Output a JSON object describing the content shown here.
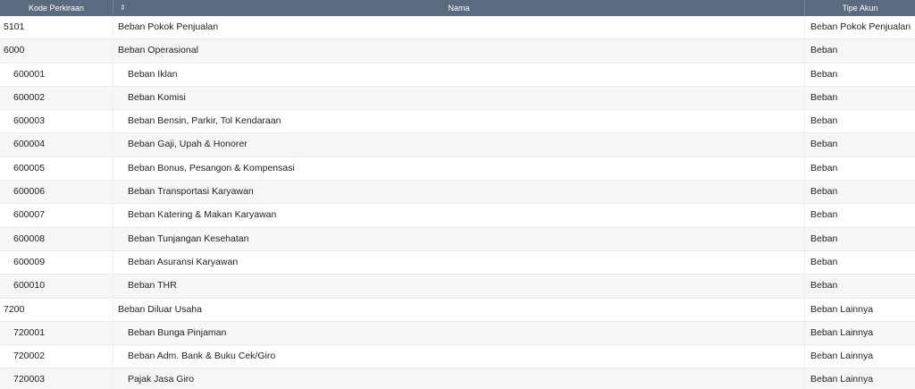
{
  "header": {
    "kode": "Kode Perkiraan",
    "sort_icon": "⇕",
    "nama": "Nama",
    "tipe": "Tipe Akun"
  },
  "rows": [
    {
      "kode": "5101",
      "nama": "Beban Pokok Penjualan",
      "tipe": "Beban Pokok Penjualan",
      "child": false
    },
    {
      "kode": "6000",
      "nama": "Beban Operasional",
      "tipe": "Beban",
      "child": false
    },
    {
      "kode": "600001",
      "nama": "Beban Iklan",
      "tipe": "Beban",
      "child": true
    },
    {
      "kode": "600002",
      "nama": "Beban Komisi",
      "tipe": "Beban",
      "child": true
    },
    {
      "kode": "600003",
      "nama": "Beban Bensin, Parkir, Tol Kendaraan",
      "tipe": "Beban",
      "child": true
    },
    {
      "kode": "600004",
      "nama": "Beban Gaji, Upah & Honorer",
      "tipe": "Beban",
      "child": true
    },
    {
      "kode": "600005",
      "nama": "Beban Bonus, Pesangon & Kompensasi",
      "tipe": "Beban",
      "child": true
    },
    {
      "kode": "600006",
      "nama": "Beban Transportasi Karyawan",
      "tipe": "Beban",
      "child": true
    },
    {
      "kode": "600007",
      "nama": "Beban Katering & Makan Karyawan",
      "tipe": "Beban",
      "child": true
    },
    {
      "kode": "600008",
      "nama": "Beban Tunjangan Kesehatan",
      "tipe": "Beban",
      "child": true
    },
    {
      "kode": "600009",
      "nama": "Beban Asuransi Karyawan",
      "tipe": "Beban",
      "child": true
    },
    {
      "kode": "600010",
      "nama": "Beban THR",
      "tipe": "Beban",
      "child": true
    },
    {
      "kode": "7200",
      "nama": "Beban Diluar Usaha",
      "tipe": "Beban Lainnya",
      "child": false
    },
    {
      "kode": "720001",
      "nama": "Beban Bunga Pinjaman",
      "tipe": "Beban Lainnya",
      "child": true
    },
    {
      "kode": "720002",
      "nama": "Beban Adm. Bank & Buku Cek/Giro",
      "tipe": "Beban Lainnya",
      "child": true
    },
    {
      "kode": "720003",
      "nama": "Pajak Jasa Giro",
      "tipe": "Beban Lainnya",
      "child": true
    }
  ]
}
